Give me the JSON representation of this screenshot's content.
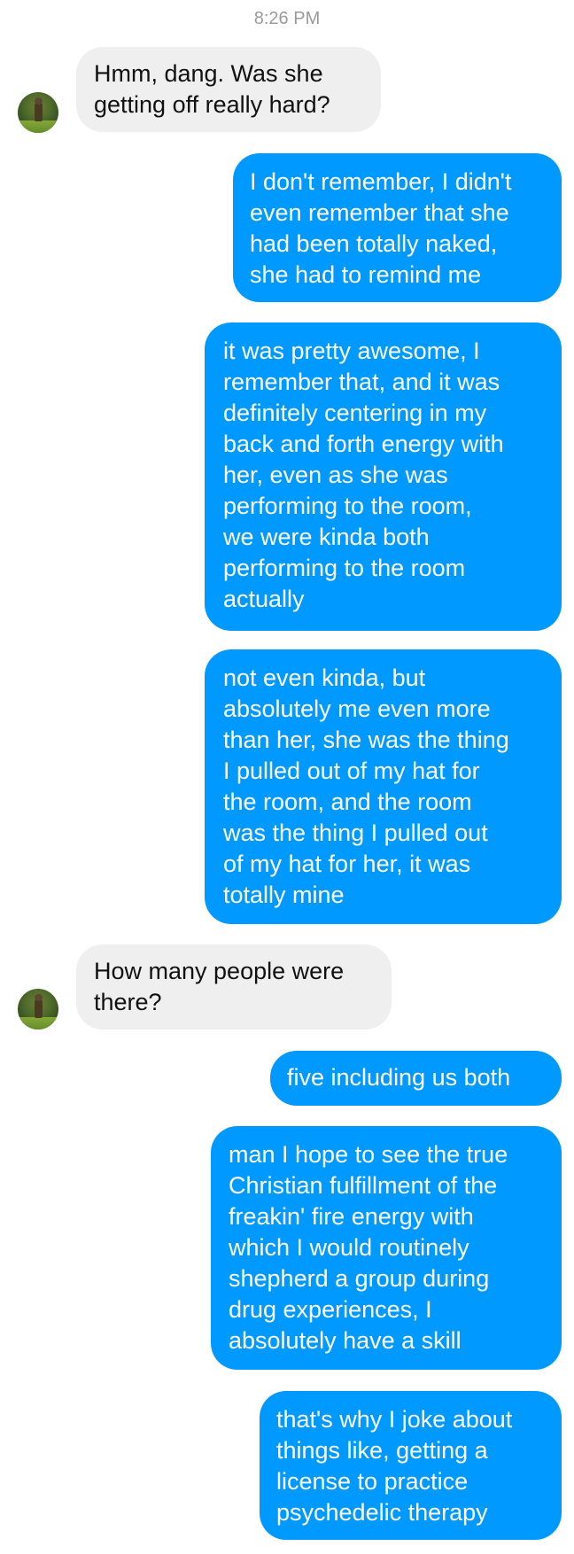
{
  "thread": {
    "timestamp": "8:26 PM",
    "accent_color": "#0099ff",
    "incoming_bubble_color": "#efefef",
    "avatar_icon": "contact-avatar-icon"
  },
  "messages": [
    {
      "direction": "incoming",
      "text": "Hmm, dang. Was she\ngetting off really hard?"
    },
    {
      "direction": "outgoing",
      "text": "I don't remember, I didn't\neven remember that she\nhad been totally naked,\nshe had to remind me"
    },
    {
      "direction": "outgoing",
      "text": "it was pretty awesome, I\nremember that, and it was\ndefinitely centering in my\nback and forth energy with\nher, even as she was\nperforming to the room,\nwe were kinda both\nperforming to the room\nactually"
    },
    {
      "direction": "outgoing",
      "text": "not even kinda, but\nabsolutely me even more\nthan her, she was the thing\nI pulled out of my hat for\nthe room, and the room\nwas the thing I pulled out\nof my hat for her, it was\ntotally mine"
    },
    {
      "direction": "incoming",
      "text": "How many people were\nthere?"
    },
    {
      "direction": "outgoing",
      "text": "five including us both"
    },
    {
      "direction": "outgoing",
      "text": "man I hope to see the true\nChristian fulfillment of the\nfreakin' fire energy with\nwhich I would routinely\nshepherd a group during\ndrug experiences, I\nabsolutely have a skill"
    },
    {
      "direction": "outgoing",
      "text": "that's why I joke about\nthings like, getting a\nlicense to practice\npsychedelic therapy"
    }
  ]
}
